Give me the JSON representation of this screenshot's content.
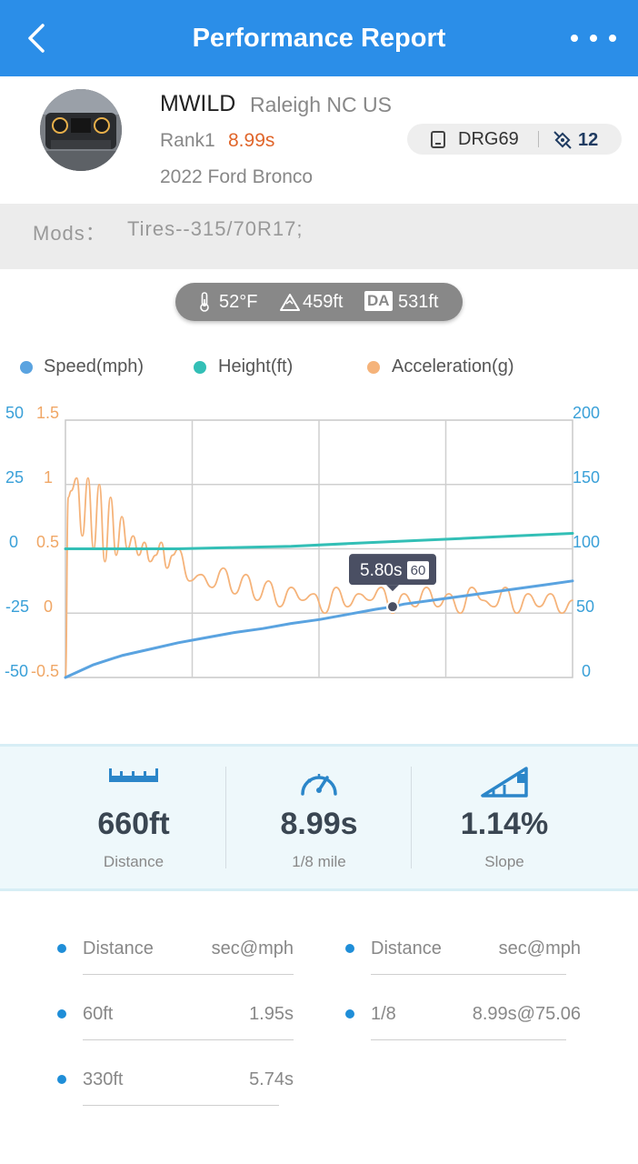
{
  "header": {
    "title": "Performance Report"
  },
  "profile": {
    "name": "MWILD",
    "location": "Raleigh NC US",
    "rank_label": "Rank1",
    "rank_time": "8.99s",
    "vehicle": "2022 Ford Bronco",
    "device": "DRG69",
    "satellites": "12"
  },
  "mods": {
    "label": "Mods：",
    "value": "Tires--315/70R17;"
  },
  "weather": {
    "temperature": "52°F",
    "altitude": "459ft",
    "da_badge": "DA",
    "density_altitude": "531ft"
  },
  "legend": [
    {
      "name": "Speed(mph)",
      "color": "#5aa3e0"
    },
    {
      "name": "Height(ft)",
      "color": "#33bfb6"
    },
    {
      "name": "Acceleration(g)",
      "color": "#f5b37a"
    }
  ],
  "chart_data": {
    "type": "line",
    "x_range": [
      0,
      8.99
    ],
    "axes": {
      "left_outer": {
        "label": "Height(ft)",
        "ticks": [
          "50",
          "25",
          "0",
          "-25",
          "-50"
        ],
        "range": [
          -50,
          50
        ],
        "color": "#3aa0d8"
      },
      "left_inner": {
        "label": "Acceleration(g)",
        "ticks": [
          "1.5",
          "1",
          "0.5",
          "0",
          "-0.5"
        ],
        "range": [
          -0.5,
          1.5
        ],
        "color": "#f0a766"
      },
      "right": {
        "label": "Speed(mph)",
        "ticks": [
          "200",
          "150",
          "100",
          "50",
          "0"
        ],
        "range": [
          0,
          200
        ],
        "color": "#3aa0d8"
      }
    },
    "series": [
      {
        "name": "Speed(mph)",
        "axis": "right",
        "color": "#5aa3e0",
        "x": [
          0,
          0.5,
          1,
          1.5,
          2,
          2.5,
          3,
          3.5,
          4,
          4.5,
          5,
          5.5,
          5.8,
          6,
          6.5,
          7,
          7.5,
          8,
          8.5,
          8.99
        ],
        "y": [
          0,
          10,
          17,
          22,
          27,
          31,
          35,
          38,
          42,
          45,
          49,
          53,
          55,
          57,
          60,
          63,
          66,
          69,
          72,
          75.06
        ]
      },
      {
        "name": "Height(ft)",
        "axis": "left_outer",
        "color": "#33bfb6",
        "x": [
          0,
          1,
          2,
          3,
          4,
          5,
          6,
          7,
          8,
          8.99
        ],
        "y": [
          0,
          0,
          0,
          0.5,
          1,
          2,
          3,
          4,
          5,
          6
        ]
      },
      {
        "name": "Acceleration(g)",
        "axis": "left_inner",
        "color": "#f5b37a",
        "x": [
          0,
          0.05,
          0.1,
          0.2,
          0.3,
          0.4,
          0.5,
          0.6,
          0.7,
          0.8,
          0.9,
          1.0,
          1.1,
          1.2,
          1.3,
          1.4,
          1.5,
          1.6,
          1.7,
          1.8,
          1.9,
          2.0,
          2.2,
          2.4,
          2.6,
          2.8,
          3.0,
          3.2,
          3.4,
          3.6,
          3.8,
          4.0,
          4.2,
          4.4,
          4.6,
          4.8,
          5.0,
          5.2,
          5.4,
          5.6,
          5.8,
          6.0,
          6.2,
          6.4,
          6.6,
          6.8,
          7.0,
          7.2,
          7.4,
          7.6,
          7.8,
          8.0,
          8.2,
          8.4,
          8.6,
          8.8,
          8.99
        ],
        "y": [
          -0.5,
          0.9,
          0.95,
          1.05,
          0.6,
          1.05,
          0.5,
          1.0,
          0.4,
          0.9,
          0.45,
          0.75,
          0.5,
          0.6,
          0.45,
          0.55,
          0.4,
          0.45,
          0.55,
          0.35,
          0.45,
          0.5,
          0.25,
          0.3,
          0.2,
          0.35,
          0.15,
          0.3,
          0.1,
          0.25,
          0.05,
          0.2,
          0.1,
          0.15,
          0.0,
          0.2,
          0.05,
          0.15,
          0.1,
          0.2,
          0.0,
          0.15,
          0.05,
          0.2,
          0.05,
          0.15,
          0.0,
          0.2,
          0.1,
          0.05,
          0.2,
          0.0,
          0.15,
          0.05,
          0.15,
          0.0,
          0.1
        ]
      }
    ],
    "tooltip": {
      "x": 5.8,
      "speed": 55,
      "time_label": "5.80s",
      "badge": "60"
    },
    "grid": true
  },
  "stats": [
    {
      "icon": "ruler-icon",
      "value": "660ft",
      "caption": "Distance"
    },
    {
      "icon": "speedometer-icon",
      "value": "8.99s",
      "caption": "1/8 mile"
    },
    {
      "icon": "slope-icon",
      "value": "1.14%",
      "caption": "Slope"
    }
  ],
  "splits": {
    "left": [
      {
        "c1": "Distance",
        "c2": "sec@mph"
      },
      {
        "c1": "60ft",
        "c2": "1.95s"
      },
      {
        "c1": "330ft",
        "c2": "5.74s"
      }
    ],
    "right": [
      {
        "c1": "Distance",
        "c2": "sec@mph"
      },
      {
        "c1": "1/8",
        "c2": "8.99s@75.06"
      }
    ]
  }
}
